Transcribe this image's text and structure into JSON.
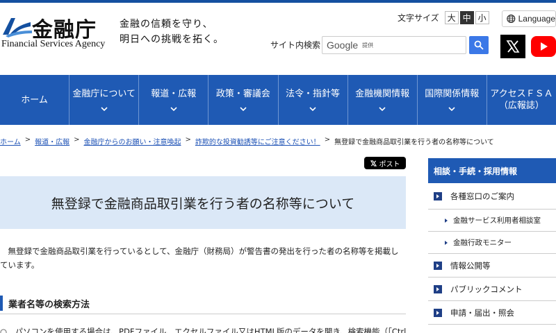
{
  "header": {
    "logo_jp": "金融庁",
    "logo_en": "Financial Services Agency",
    "tagline_line1": "金融の信頼を守り、",
    "tagline_line2": "明日への挑戦を拓く。",
    "font_size_label": "文字サイズ",
    "font_sizes": [
      "大",
      "中",
      "小"
    ],
    "font_size_selected": "中",
    "language_label": "Language",
    "site_search_label": "サイト内検索",
    "search_brand": "Google",
    "search_provided": "提供",
    "x_icon": "x-logo-icon",
    "youtube_icon": "youtube-icon"
  },
  "gnav": [
    {
      "label": "ホーム",
      "has_chevron": false
    },
    {
      "label": "金融庁について",
      "has_chevron": true
    },
    {
      "label": "報道・広報",
      "has_chevron": true
    },
    {
      "label": "政策・審議会",
      "has_chevron": true
    },
    {
      "label": "法令・指針等",
      "has_chevron": true
    },
    {
      "label": "金融機関情報",
      "has_chevron": true
    },
    {
      "label": "国際関係情報",
      "has_chevron": true
    },
    {
      "label": "アクセスＦＳＡ\n（広報誌）",
      "has_chevron": false
    }
  ],
  "breadcrumb": {
    "items": [
      "ホーム",
      "報道・広報",
      "金融庁からのお願い・注意喚起",
      "詐欺的な投資勧誘等にご注意ください！"
    ],
    "separator": ">",
    "current": "無登録で金融商品取引業を行う者の名称等について"
  },
  "main": {
    "post_label": "ポスト",
    "title": "無登録で金融商品取引業を行う者の名称等について",
    "intro": "無登録で金融商品取引業を行っているとして、金融庁（財務局）が警告書の発出を行った者の名称等を掲載しています。",
    "section_heading": "業者名等の検索方法",
    "section_body": "○　パソコンを使用する場合は、PDFファイル、エクセルファイル又はHTML版のデータを開き、検索機能（「Ctrl」"
  },
  "sidenav": {
    "heading": "相談・手続・採用情報",
    "items": [
      {
        "label": "各種窓口のご案内",
        "level": 1
      },
      {
        "label": "金融サービス利用者相談室",
        "level": 2
      },
      {
        "label": "金融行政モニター",
        "level": 2
      },
      {
        "label": "情報公開等",
        "level": 1
      },
      {
        "label": "パブリックコメント",
        "level": 1
      },
      {
        "label": "申請・届出・照会",
        "level": 1
      }
    ]
  },
  "colors": {
    "brand_blue": "#1f5ab4",
    "title_bg": "#dbe8f7",
    "link": "#1a4fb4"
  }
}
